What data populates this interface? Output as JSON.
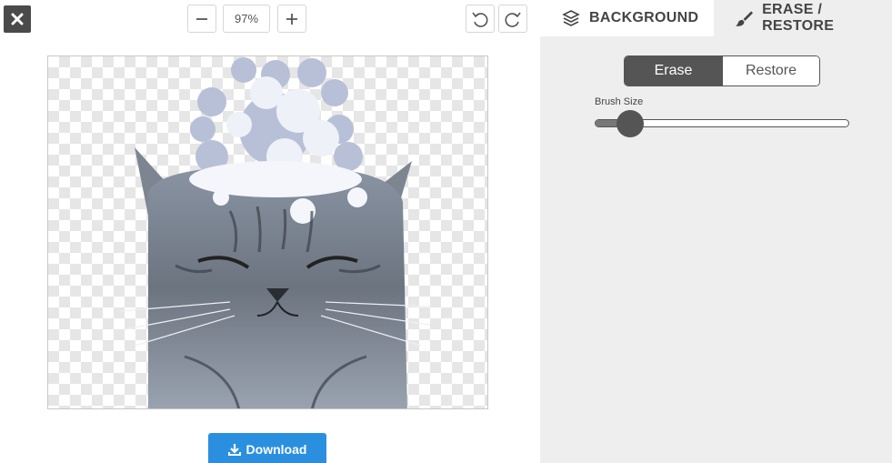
{
  "toolbar": {
    "close_icon": "close-x-icon",
    "zoom_out_icon": "minus-icon",
    "zoom_value": "97%",
    "zoom_in_icon": "plus-icon",
    "undo_icon": "undo-icon",
    "redo_icon": "redo-icon"
  },
  "tabs": [
    {
      "label": "BACKGROUND",
      "icon": "layers-icon",
      "active": false
    },
    {
      "label": "ERASE / RESTORE",
      "icon": "brush-icon",
      "active": true
    }
  ],
  "mode": {
    "options": [
      "Erase",
      "Restore"
    ],
    "selected": "Erase"
  },
  "brush": {
    "label": "Brush Size",
    "value_fraction": 0.1
  },
  "download": {
    "label": "Download",
    "icon": "download-icon"
  },
  "colors": {
    "accent_blue": "#2b8fe0",
    "dark": "#555555",
    "panel_bg": "#eeeeee"
  }
}
